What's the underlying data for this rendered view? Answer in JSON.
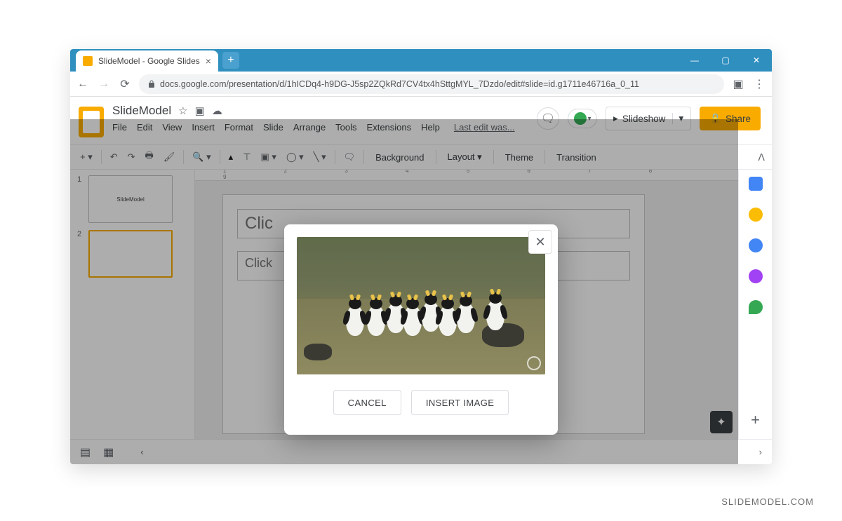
{
  "browser": {
    "tab_title": "SlideModel - Google Slides",
    "url": "docs.google.com/presentation/d/1hICDq4-h9DG-J5sp2ZQkRd7CV4tx4hSttgMYL_7Dzdo/edit#slide=id.g1711e46716a_0_11"
  },
  "header": {
    "doc_title": "SlideModel",
    "last_edit": "Last edit was...",
    "slideshow_label": "Slideshow",
    "share_label": "Share"
  },
  "menus": [
    "File",
    "Edit",
    "View",
    "Insert",
    "Format",
    "Slide",
    "Arrange",
    "Tools",
    "Extensions",
    "Help"
  ],
  "toolbar": {
    "background": "Background",
    "layout": "Layout",
    "theme": "Theme",
    "transition": "Transition"
  },
  "thumbnails": [
    {
      "num": "1",
      "label": "SlideModel",
      "selected": false
    },
    {
      "num": "2",
      "label": "",
      "selected": true
    }
  ],
  "slide": {
    "title_ph": "Clic",
    "body_ph": "Click"
  },
  "dialog": {
    "cancel": "CANCEL",
    "insert": "INSERT IMAGE"
  },
  "ruler": "1 2 3 4 5 6 7 8 9",
  "footer": "SLIDEMODEL.COM"
}
